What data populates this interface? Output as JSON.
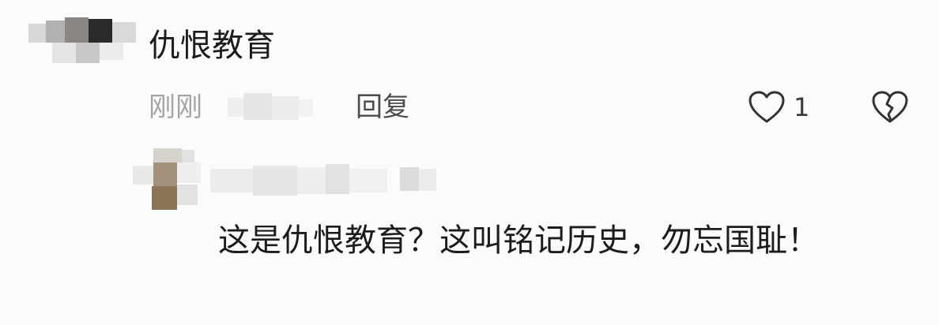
{
  "comment": {
    "text": "仇恨教育",
    "timestamp": "刚刚",
    "reply_label": "回复",
    "like_count": "1",
    "like_icon": "heart-outline-icon",
    "dislike_icon": "broken-heart-icon"
  },
  "reply": {
    "text": "这是仇恨教育？这叫铭记历史，勿忘国耻！"
  },
  "colors": {
    "background": "#fbfbfb",
    "text_primary": "#1c1c1c",
    "text_muted": "#a4a4a4",
    "icon": "#333333"
  }
}
